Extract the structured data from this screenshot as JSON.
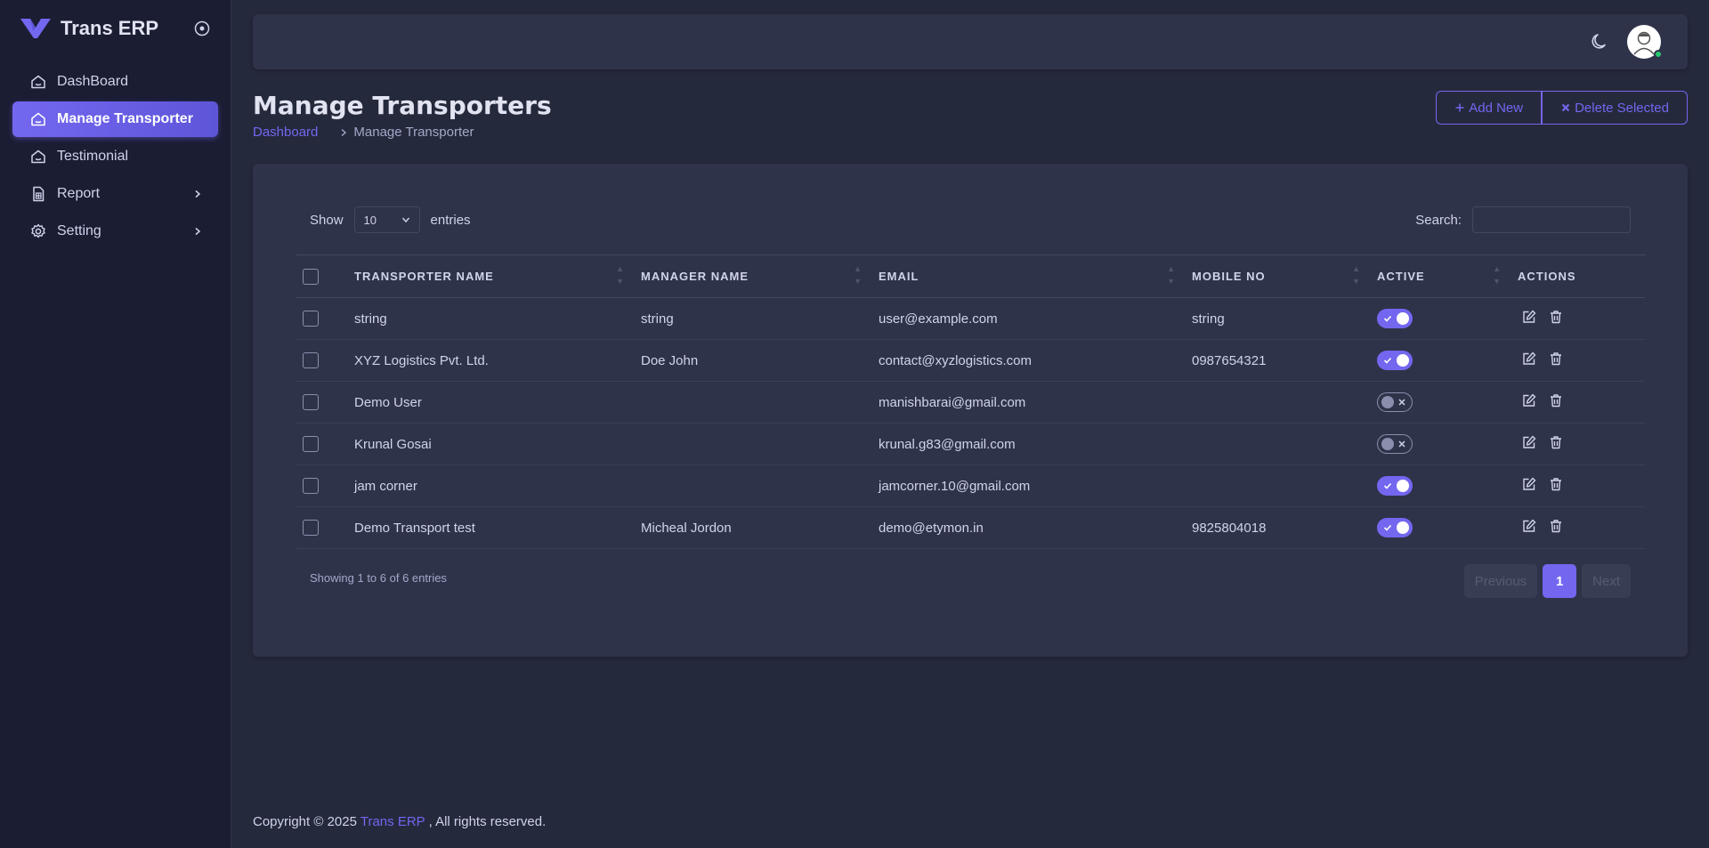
{
  "brand": {
    "name": "Trans ERP"
  },
  "sidebar": {
    "items": [
      {
        "label": "DashBoard",
        "icon": "home-icon",
        "active": false,
        "submenu": false
      },
      {
        "label": "Manage Transporter",
        "icon": "home-icon",
        "active": true,
        "submenu": false
      },
      {
        "label": "Testimonial",
        "icon": "home-icon",
        "active": false,
        "submenu": false
      },
      {
        "label": "Report",
        "icon": "report-icon",
        "active": false,
        "submenu": true
      },
      {
        "label": "Setting",
        "icon": "gear-icon",
        "active": false,
        "submenu": true
      }
    ]
  },
  "header": {
    "title": "Manage Transporters",
    "breadcrumb": {
      "home": "Dashboard",
      "current": "Manage Transporter"
    },
    "add_label": "Add New",
    "delete_label": "Delete Selected"
  },
  "table_controls": {
    "show_label": "Show",
    "entries_value": "10",
    "entries_label": "entries",
    "search_label": "Search:",
    "search_value": ""
  },
  "table": {
    "columns": [
      "TRANSPORTER NAME",
      "MANAGER NAME",
      "EMAIL",
      "MOBILE NO",
      "ACTIVE",
      "ACTIONS"
    ],
    "rows": [
      {
        "transporter": "string",
        "manager": "string",
        "email": "user@example.com",
        "mobile": "string",
        "active": true
      },
      {
        "transporter": "XYZ Logistics Pvt. Ltd.",
        "manager": "Doe John",
        "email": "contact@xyzlogistics.com",
        "mobile": "0987654321",
        "active": true
      },
      {
        "transporter": "Demo User",
        "manager": "",
        "email": "manishbarai@gmail.com",
        "mobile": "",
        "active": false
      },
      {
        "transporter": "Krunal Gosai",
        "manager": "",
        "email": "krunal.g83@gmail.com",
        "mobile": "",
        "active": false
      },
      {
        "transporter": "jam corner",
        "manager": "",
        "email": "jamcorner.10@gmail.com",
        "mobile": "",
        "active": true
      },
      {
        "transporter": "Demo Transport test",
        "manager": "Micheal Jordon",
        "email": "demo@etymon.in",
        "mobile": "9825804018",
        "active": true
      }
    ]
  },
  "pagination": {
    "info": "Showing 1 to 6 of 6 entries",
    "previous": "Previous",
    "current": "1",
    "next": "Next"
  },
  "footer": {
    "prefix": "Copyright © 2025",
    "brand": "Trans ERP",
    "suffix": ", All rights reserved."
  },
  "colors": {
    "accent": "#7367f0",
    "background": "#25293c",
    "card": "#2f3349",
    "sidebar": "#1b1d33",
    "online": "#28c76f"
  }
}
